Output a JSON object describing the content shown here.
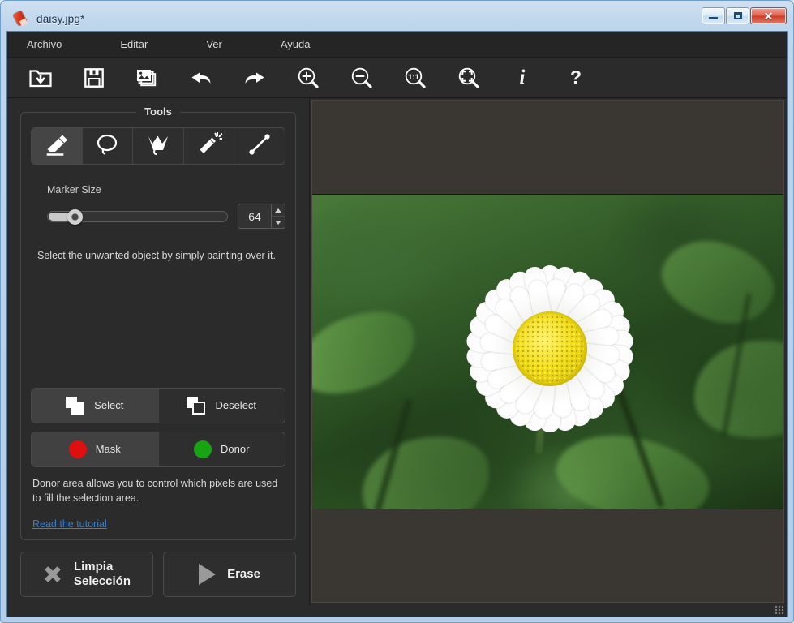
{
  "window": {
    "title": "daisy.jpg*",
    "icon": "app-eraser-icon",
    "minimize_label": "",
    "maximize_label": "",
    "close_label": "✕"
  },
  "menubar": {
    "items": [
      {
        "label": "Archivo",
        "name": "menu-archivo"
      },
      {
        "label": "Editar",
        "name": "menu-editar"
      },
      {
        "label": "Ver",
        "name": "menu-ver"
      },
      {
        "label": "Ayuda",
        "name": "menu-ayuda"
      }
    ]
  },
  "toolbar": {
    "buttons": [
      {
        "icon": "open-folder-icon",
        "label": ""
      },
      {
        "icon": "save-floppy-icon",
        "label": ""
      },
      {
        "icon": "batch-images-icon",
        "label": ""
      },
      {
        "icon": "undo-arrow-icon",
        "label": ""
      },
      {
        "icon": "redo-arrow-icon",
        "label": ""
      },
      {
        "icon": "zoom-in-icon",
        "label": ""
      },
      {
        "icon": "zoom-out-icon",
        "label": ""
      },
      {
        "icon": "zoom-actual-size-icon",
        "label": "1:1"
      },
      {
        "icon": "zoom-fit-icon",
        "label": ""
      },
      {
        "icon": "info-icon",
        "label": "i"
      },
      {
        "icon": "help-icon",
        "label": "?"
      }
    ]
  },
  "tools_panel": {
    "group_title": "Tools",
    "tools": [
      {
        "name": "marker-tool",
        "icon": "marker-pen-icon",
        "active": true
      },
      {
        "name": "lasso-tool",
        "icon": "lasso-icon",
        "active": false
      },
      {
        "name": "polygon-lasso-tool",
        "icon": "polygon-lasso-icon",
        "active": false
      },
      {
        "name": "magic-wand-tool",
        "icon": "magic-wand-icon",
        "active": false
      },
      {
        "name": "line-tool",
        "icon": "line-icon",
        "active": false
      }
    ],
    "marker_size": {
      "label": "Marker Size",
      "value": "64",
      "percent": 13
    },
    "hint": "Select the unwanted object by simply painting over it.",
    "select_row": [
      {
        "label": "Select",
        "icon": "filled-squares-icon",
        "active": true
      },
      {
        "label": "Deselect",
        "icon": "outlined-square-icon",
        "active": false
      }
    ],
    "mask_row": [
      {
        "label": "Mask",
        "icon": "red-circle-icon",
        "color": "#e00f0f",
        "active": true
      },
      {
        "label": "Donor",
        "icon": "green-circle-icon",
        "color": "#17a312",
        "active": false
      }
    ],
    "donor_note": "Donor area allows you to control which pixels are used to fill the selection area.",
    "tutorial_link": "Read the tutorial"
  },
  "actions": {
    "clear_selection": {
      "line1": "Limpia",
      "line2": "Selección",
      "icon": "x-cross-icon"
    },
    "erase": {
      "label": "Erase",
      "icon": "play-triangle-icon"
    }
  },
  "canvas": {
    "background_color": "#3a3733",
    "image_alt": "daisy.jpg"
  }
}
